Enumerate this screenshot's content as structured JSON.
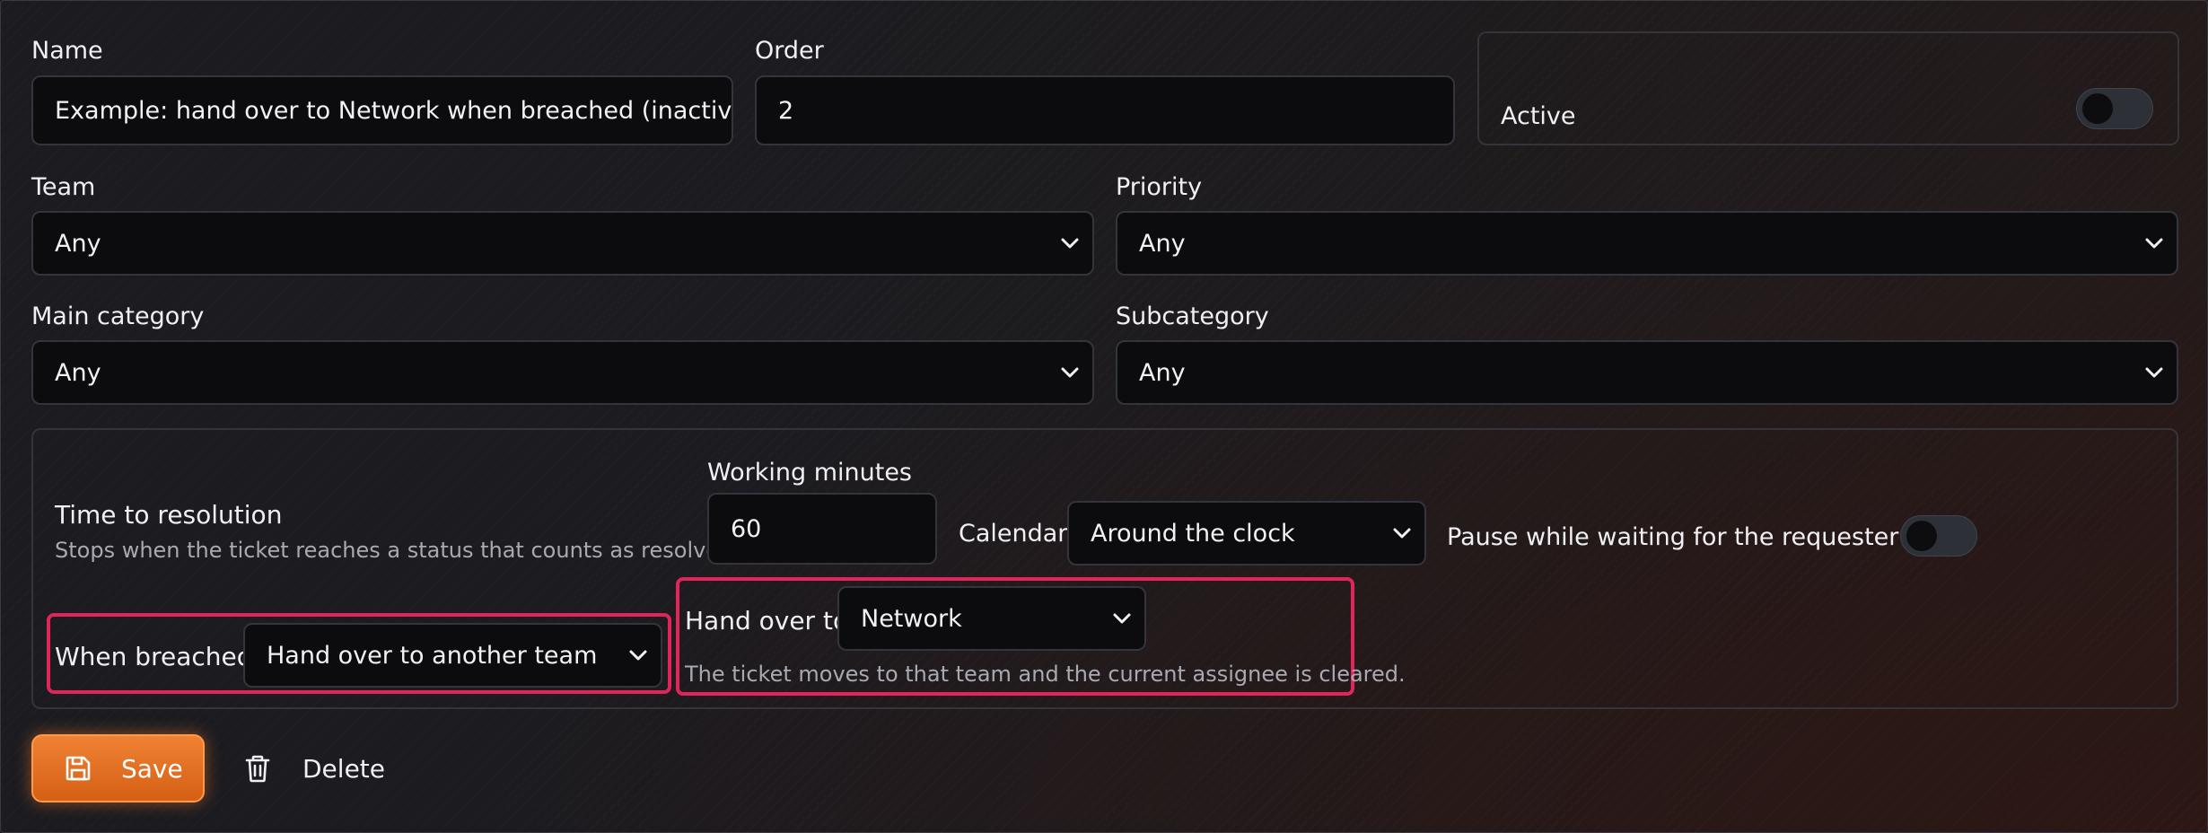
{
  "form": {
    "name": {
      "label": "Name",
      "value": "Example: hand over to Network when breached (inactive"
    },
    "order": {
      "label": "Order",
      "value": "2"
    },
    "active": {
      "label": "Active",
      "on": false
    },
    "team": {
      "label": "Team",
      "value": "Any"
    },
    "priority": {
      "label": "Priority",
      "value": "Any"
    },
    "main_category": {
      "label": "Main category",
      "value": "Any"
    },
    "subcategory": {
      "label": "Subcategory",
      "value": "Any"
    }
  },
  "sla": {
    "title": "Time to resolution",
    "description": "Stops when the ticket reaches a status that counts as resolved.",
    "working_minutes": {
      "label": "Working minutes",
      "value": "60"
    },
    "calendar": {
      "label": "Calendar",
      "value": "Around the clock"
    },
    "pause": {
      "label": "Pause while waiting for the requester",
      "on": false
    },
    "when_breached": {
      "label": "When breached",
      "value": "Hand over to another team"
    },
    "hand_over_to": {
      "label": "Hand over to",
      "value": "Network"
    },
    "hand_over_hint": "The ticket moves to that team and the current assignee is cleared."
  },
  "actions": {
    "save_label": "Save",
    "delete_label": "Delete"
  },
  "colors": {
    "accent": "#e97a2b",
    "highlight": "#e3245a",
    "field_bg": "#0c0c0f"
  },
  "icons": [
    "chevron-down-icon",
    "save-icon",
    "trash-icon"
  ]
}
